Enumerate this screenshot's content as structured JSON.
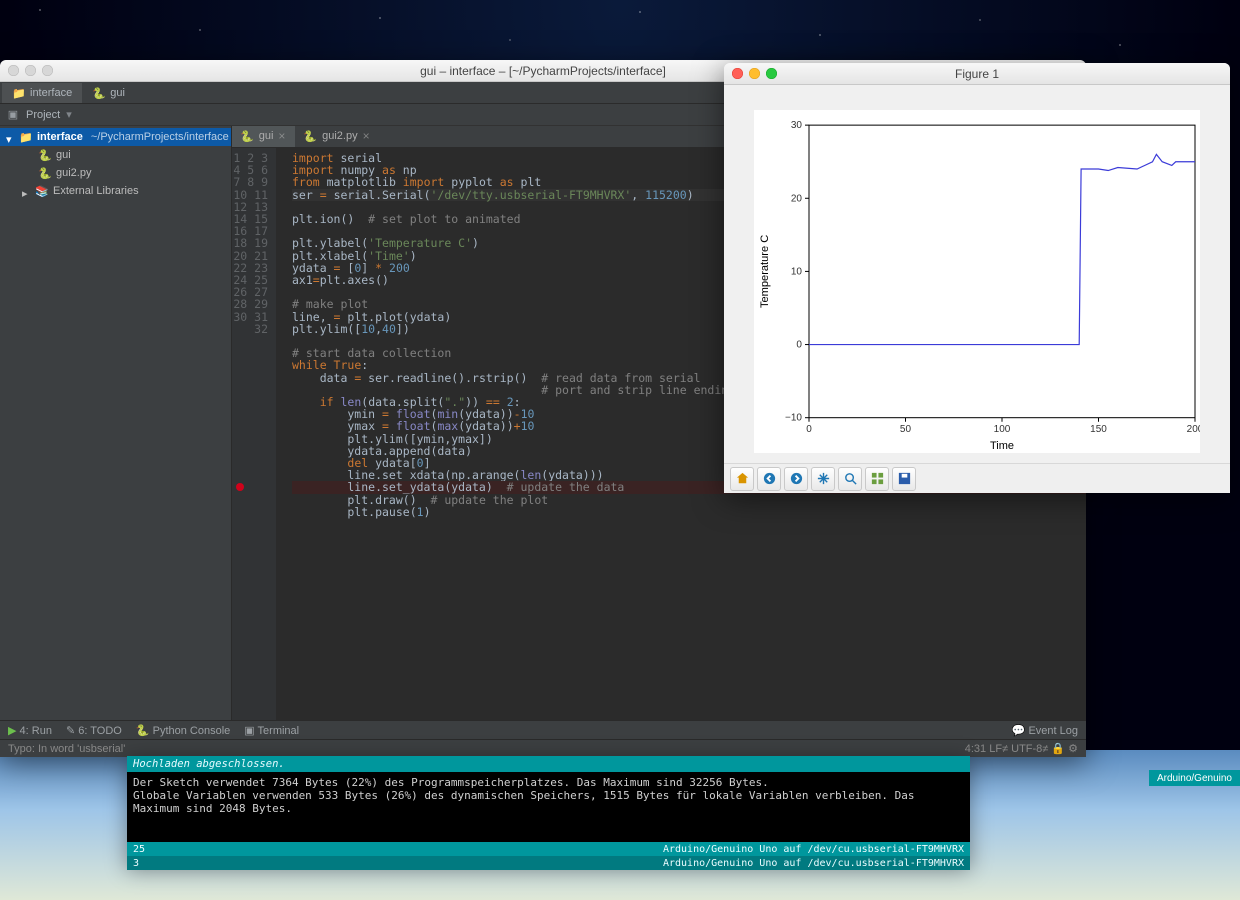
{
  "mac_titlebar_pycharm": "gui – interface – [~/PycharmProjects/interface]",
  "pycharm": {
    "top_tabs": {
      "breadcrumb": "interface",
      "file": "gui"
    },
    "toolbar": {
      "project_label": "Project"
    },
    "tree": {
      "root": "interface",
      "root_path": "~/PycharmProjects/interface",
      "items": [
        "gui",
        "gui2.py"
      ],
      "external": "External Libraries"
    },
    "editor_tabs": [
      {
        "name": "gui",
        "active": true
      },
      {
        "name": "gui2.py",
        "active": false
      }
    ],
    "line_count": 32,
    "breakpoint_line": 28,
    "statusbar": {
      "run": "4: Run",
      "todo": "6: TODO",
      "python_console": "Python Console",
      "terminal": "Terminal",
      "event_log": "Event Log"
    },
    "typobar_left": "Typo: In word 'usbserial'",
    "typobar_right": "4:31  LF≠  UTF-8≠  🔒  ⚙"
  },
  "code_lines": [
    [
      [
        "kw",
        "import"
      ],
      [
        "op",
        " serial"
      ]
    ],
    [
      [
        "kw",
        "import"
      ],
      [
        "op",
        " numpy "
      ],
      [
        "kw",
        "as"
      ],
      [
        "op",
        " np"
      ]
    ],
    [
      [
        "kw",
        "from"
      ],
      [
        "op",
        " matplotlib "
      ],
      [
        "kw",
        "import"
      ],
      [
        "op",
        " pyplot "
      ],
      [
        "kw",
        "as"
      ],
      [
        "op",
        " plt"
      ]
    ],
    [
      [
        "op",
        "ser "
      ],
      [
        "kw",
        "="
      ],
      [
        "op",
        " serial.Serial("
      ],
      [
        "str",
        "'/dev/tty.usbserial-FT9MHVRX'"
      ],
      [
        "op",
        ", "
      ],
      [
        "num",
        "115200"
      ],
      [
        "op",
        ")"
      ]
    ],
    [
      [
        "op",
        ""
      ]
    ],
    [
      [
        "op",
        "plt.ion()  "
      ],
      [
        "cmt",
        "# set plot to animated"
      ]
    ],
    [
      [
        "op",
        ""
      ]
    ],
    [
      [
        "op",
        "plt.ylabel("
      ],
      [
        "str",
        "'Temperature C'"
      ],
      [
        "op",
        ")"
      ]
    ],
    [
      [
        "op",
        "plt.xlabel("
      ],
      [
        "str",
        "'Time'"
      ],
      [
        "op",
        ")"
      ]
    ],
    [
      [
        "op",
        "ydata "
      ],
      [
        "kw",
        "="
      ],
      [
        "op",
        " ["
      ],
      [
        "num",
        "0"
      ],
      [
        "op",
        "] "
      ],
      [
        "kw",
        "*"
      ],
      [
        "op",
        " "
      ],
      [
        "num",
        "200"
      ]
    ],
    [
      [
        "op",
        "ax1"
      ],
      [
        "kw",
        "="
      ],
      [
        "op",
        "plt.axes()"
      ]
    ],
    [
      [
        "op",
        ""
      ]
    ],
    [
      [
        "cmt",
        "# make plot"
      ]
    ],
    [
      [
        "op",
        "line, "
      ],
      [
        "kw",
        "="
      ],
      [
        "op",
        " plt.plot(ydata)"
      ]
    ],
    [
      [
        "op",
        "plt.ylim(["
      ],
      [
        "num",
        "10"
      ],
      [
        "op",
        ","
      ],
      [
        "num",
        "40"
      ],
      [
        "op",
        "])"
      ]
    ],
    [
      [
        "op",
        ""
      ]
    ],
    [
      [
        "cmt",
        "# start data collection"
      ]
    ],
    [
      [
        "kw",
        "while "
      ],
      [
        "kw2",
        "True"
      ],
      [
        "op",
        ":"
      ]
    ],
    [
      [
        "op",
        "    data "
      ],
      [
        "kw",
        "="
      ],
      [
        "op",
        " ser.readline().rstrip()  "
      ],
      [
        "cmt",
        "# read data from serial"
      ]
    ],
    [
      [
        "op",
        "                                    "
      ],
      [
        "cmt",
        "# port and strip line endings"
      ]
    ],
    [
      [
        "op",
        "    "
      ],
      [
        "kw",
        "if "
      ],
      [
        "builtin",
        "len"
      ],
      [
        "op",
        "(data.split("
      ],
      [
        "str",
        "\".\""
      ],
      [
        "op",
        ")) "
      ],
      [
        "kw",
        "=="
      ],
      [
        "op",
        " "
      ],
      [
        "num",
        "2"
      ],
      [
        "op",
        ":"
      ]
    ],
    [
      [
        "op",
        "        ymin "
      ],
      [
        "kw",
        "="
      ],
      [
        "op",
        " "
      ],
      [
        "builtin",
        "float"
      ],
      [
        "op",
        "("
      ],
      [
        "builtin",
        "min"
      ],
      [
        "op",
        "(ydata))"
      ],
      [
        "kw",
        "-"
      ],
      [
        "num",
        "10"
      ]
    ],
    [
      [
        "op",
        "        ymax "
      ],
      [
        "kw",
        "="
      ],
      [
        "op",
        " "
      ],
      [
        "builtin",
        "float"
      ],
      [
        "op",
        "("
      ],
      [
        "builtin",
        "max"
      ],
      [
        "op",
        "(ydata))"
      ],
      [
        "kw",
        "+"
      ],
      [
        "num",
        "10"
      ]
    ],
    [
      [
        "op",
        "        plt.ylim([ymin,ymax])"
      ]
    ],
    [
      [
        "op",
        "        ydata.append(data)"
      ]
    ],
    [
      [
        "op",
        "        "
      ],
      [
        "kw",
        "del "
      ],
      [
        "op",
        "ydata["
      ],
      [
        "num",
        "0"
      ],
      [
        "op",
        "]"
      ]
    ],
    [
      [
        "op",
        "        line.set_xdata(np.arange("
      ],
      [
        "builtin",
        "len"
      ],
      [
        "op",
        "(ydata)))"
      ]
    ],
    [
      [
        "op",
        "        line.set_ydata(ydata)  "
      ],
      [
        "cmt",
        "# update the data"
      ]
    ],
    [
      [
        "op",
        "        plt.draw()  "
      ],
      [
        "cmt",
        "# update the plot"
      ]
    ],
    [
      [
        "op",
        "        plt.pause("
      ],
      [
        "num",
        "1"
      ],
      [
        "op",
        ")"
      ]
    ],
    [
      [
        "op",
        ""
      ]
    ],
    [
      [
        "op",
        ""
      ]
    ]
  ],
  "figure": {
    "title": "Figure 1",
    "toolbar_icons": [
      "home",
      "back",
      "forward",
      "pan",
      "zoom",
      "subplots",
      "save"
    ]
  },
  "chart_data": {
    "type": "line",
    "title": "",
    "xlabel": "Time",
    "ylabel": "Temperature C",
    "xlim": [
      0,
      200
    ],
    "ylim": [
      -10,
      30
    ],
    "xticks": [
      0,
      50,
      100,
      150,
      200
    ],
    "yticks": [
      -10,
      0,
      10,
      20,
      30
    ],
    "x": [
      0,
      140,
      141,
      150,
      155,
      160,
      170,
      178,
      180,
      183,
      188,
      190,
      200
    ],
    "y": [
      0,
      0,
      24,
      24,
      23.8,
      24.2,
      24,
      25,
      26,
      25,
      24.5,
      25,
      25
    ]
  },
  "arduino": {
    "header": "Hochladen abgeschlossen.",
    "body": "Der Sketch verwendet 7364 Bytes (22%) des Programmspeicherplatzes. Das Maximum sind 32256 Bytes.\nGlobale Variablen verwenden 533 Bytes (26%) des dynamischen Speichers, 1515 Bytes für lokale Variablen verbleiben. Das Maximum sind 2048 Bytes.",
    "foot_left": "25",
    "foot_right": "Arduino/Genuino Uno auf /dev/cu.usbserial-FT9MHVRX",
    "foot2_left": "3",
    "foot2_right": "Arduino/Genuino Uno auf /dev/cu.usbserial-FT9MHVRX",
    "side_label": "Arduino/Genuino"
  }
}
